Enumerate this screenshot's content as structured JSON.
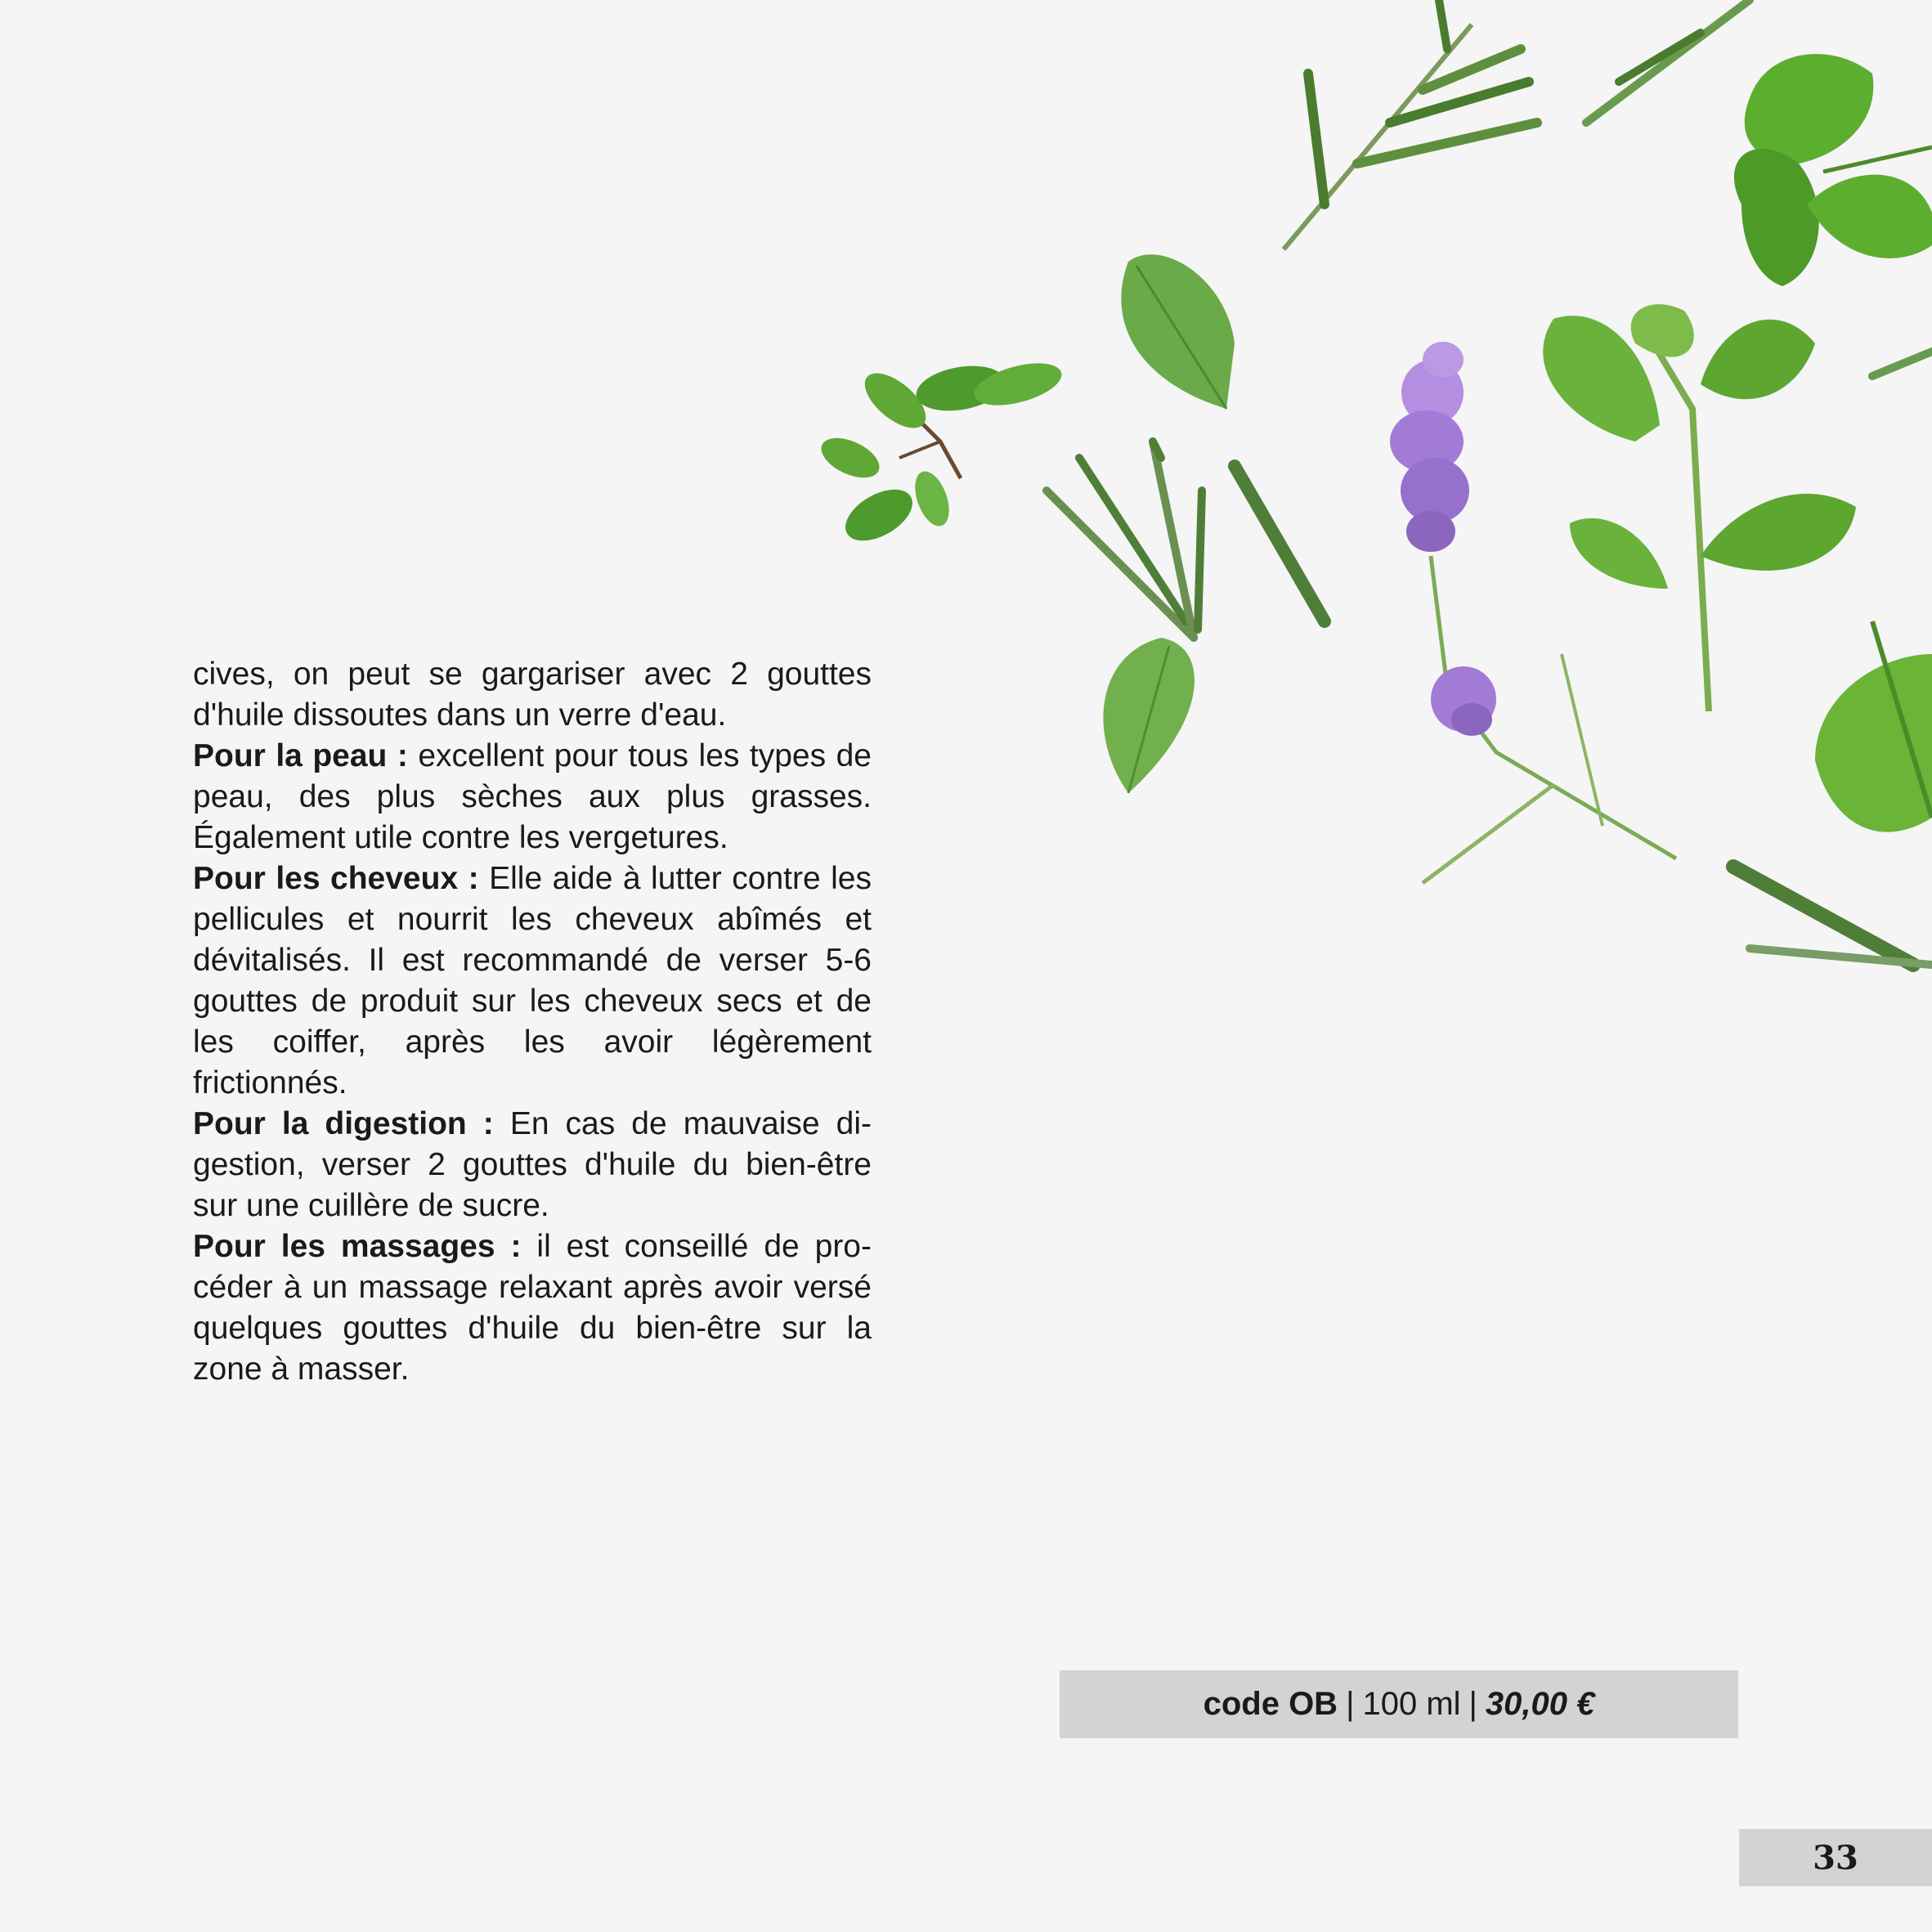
{
  "colors": {
    "background": "#f5f5f5",
    "bar_gray": "#d3d3d3",
    "text": "#1a1a1a",
    "leaf_green": "#5fa835",
    "leaf_dark": "#3e7d22",
    "lavender": "#a27bd6"
  },
  "illustration": {
    "icons": [
      "rosemary-sprig-icon",
      "parsley-leaf-icon",
      "mint-leaf-icon",
      "thyme-sprig-icon",
      "lavender-flower-icon",
      "basil-leaf-icon",
      "lemon-balm-sprig-icon"
    ]
  },
  "content": {
    "para1": "cives, on peut se gargariser avec 2 gouttes d'huile dissoutes dans un verre d'eau.",
    "para2_label": "Pour la peau :",
    "para2_text": " excellent pour tous les types de peau, des plus sèches aux plus grasses. Également utile contre les vergetures.",
    "para3_label": "Pour les cheveux :",
    "para3_text": " Elle aide à lutter contre les pellicules et nourrit les cheveux abîmés et dévitalisés. Il est recommandé de ver­ser 5-6 gouttes de produit sur les cheveux secs et de les coiffer, après les avoir légère­ment frictionnés.",
    "para4_label": "Pour la digestion :",
    "para4_text": " En cas de mauvaise di­gestion, verser 2 gouttes d'huile du bien-être sur une cuillère de sucre.",
    "para5_label": "Pour les massages :",
    "para5_text": " il est conseillé de pro­céder à un massage relaxant après avoir versé quelques gouttes d'huile du bien-être sur la zone à masser."
  },
  "product": {
    "code": "code OB",
    "separator": "|",
    "volume": "100 ml",
    "price": "30,00 €"
  },
  "page": {
    "number": "33"
  }
}
